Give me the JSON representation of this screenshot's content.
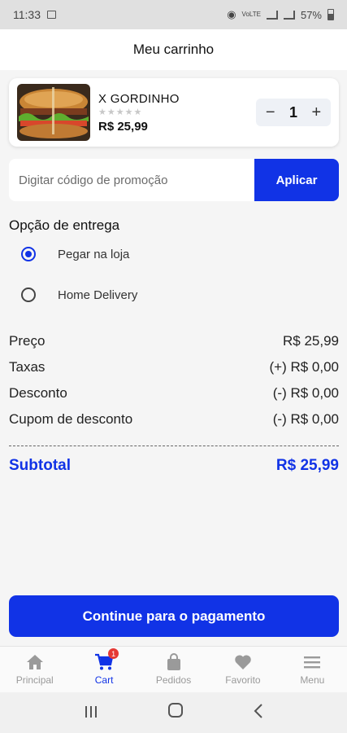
{
  "status": {
    "time": "11:33",
    "battery": "57%",
    "network": "VoLTE"
  },
  "header": {
    "title": "Meu carrinho"
  },
  "cart_item": {
    "name": "X GORDINHO",
    "rating": 0,
    "max_rating": 5,
    "price": "R$ 25,99",
    "quantity": "1",
    "minus": "−",
    "plus": "+"
  },
  "promo": {
    "placeholder": "Digitar código de promoção",
    "value": "",
    "button": "Aplicar"
  },
  "delivery": {
    "title": "Opção de entrega",
    "options": [
      {
        "label": "Pegar na loja",
        "selected": true
      },
      {
        "label": "Home Delivery",
        "selected": false
      }
    ]
  },
  "summary": {
    "rows": [
      {
        "label": "Preço",
        "value": "R$ 25,99"
      },
      {
        "label": "Taxas",
        "value": "(+) R$ 0,00"
      },
      {
        "label": "Desconto",
        "value": "(-) R$ 0,00"
      },
      {
        "label": "Cupom de desconto",
        "value": "(-) R$ 0,00"
      }
    ],
    "subtotal_label": "Subtotal",
    "subtotal_value": "R$ 25,99"
  },
  "continue_button": "Continue para o pagamento",
  "nav": {
    "items": [
      {
        "label": "Principal",
        "icon": "home-icon"
      },
      {
        "label": "Cart",
        "icon": "cart-icon",
        "badge": "1"
      },
      {
        "label": "Pedidos",
        "icon": "bag-icon"
      },
      {
        "label": "Favorito",
        "icon": "heart-icon"
      },
      {
        "label": "Menu",
        "icon": "menu-icon"
      }
    ]
  },
  "colors": {
    "accent": "#1133e6",
    "badge": "#e53935"
  }
}
